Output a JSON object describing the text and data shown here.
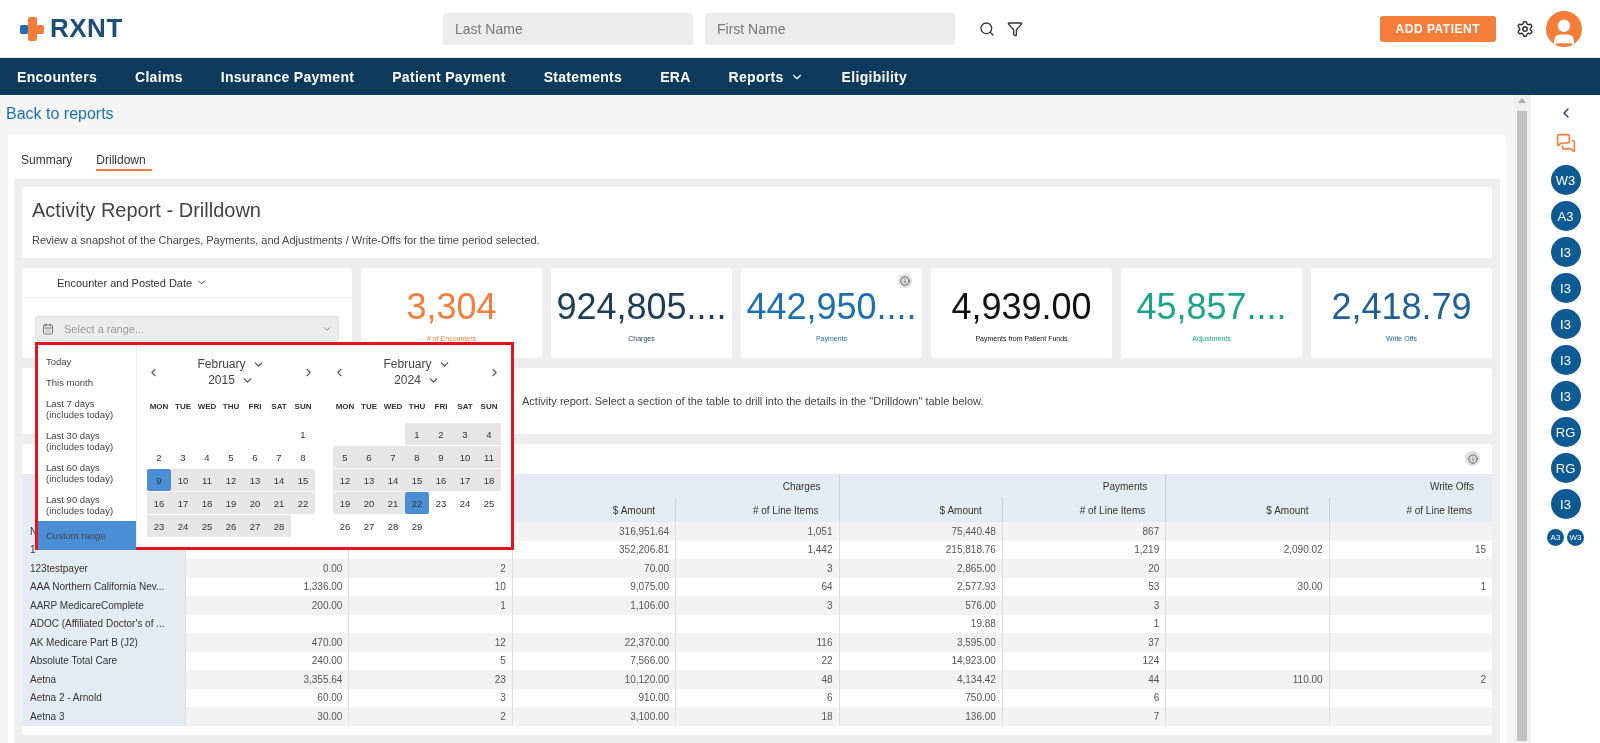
{
  "header": {
    "logo": "RXNT",
    "last_name_placeholder": "Last Name",
    "first_name_placeholder": "First Name",
    "add_button": "ADD PATIENT"
  },
  "nav": [
    {
      "label": "Encounters",
      "dropdown": false
    },
    {
      "label": "Claims",
      "dropdown": false
    },
    {
      "label": "Insurance Payment",
      "dropdown": false
    },
    {
      "label": "Patient Payment",
      "dropdown": false
    },
    {
      "label": "Statements",
      "dropdown": false
    },
    {
      "label": "ERA",
      "dropdown": false
    },
    {
      "label": "Reports",
      "dropdown": true
    },
    {
      "label": "Eligibility",
      "dropdown": false
    }
  ],
  "back_link": "Back to reports",
  "tabs": [
    {
      "label": "Summary",
      "selected": false
    },
    {
      "label": "Drilldown",
      "selected": true
    }
  ],
  "report": {
    "title": "Activity Report - Drilldown",
    "subtitle": "Review a snapshot of the Charges, Payments, and Adjustments / Write-Offs for the time period selected."
  },
  "date_filter": {
    "label": "Encounter and Posted Date",
    "placeholder": "Select a range..."
  },
  "stats": [
    {
      "value": "3,304",
      "label": "# of Encounters",
      "color": "#f47d3a",
      "info": false
    },
    {
      "value": "924,805....",
      "label": "Charges",
      "color": "#1c3d5a",
      "info": false
    },
    {
      "value": "442,950....",
      "label": "Payments",
      "color": "#1a6fb5",
      "info": true
    },
    {
      "value": "4,939.00",
      "label": "Payments from Patient Funds",
      "color": "#111111",
      "info": false
    },
    {
      "value": "45,857....",
      "label": "Adjustments",
      "color": "#1aa58a",
      "info": false
    },
    {
      "value": "2,418.79",
      "label": "Write Offs",
      "color": "#1f5f9a",
      "info": false
    }
  ],
  "date_picker": {
    "presets": [
      {
        "label": "Today",
        "selected": false
      },
      {
        "label": "This month",
        "selected": false
      },
      {
        "label": "Last 7 days\n(includes today)",
        "selected": false
      },
      {
        "label": "Last 30 days\n(includes today)",
        "selected": false
      },
      {
        "label": "Last 60 days\n(includes today)",
        "selected": false
      },
      {
        "label": "Last 90 days\n(includes today)",
        "selected": false
      },
      {
        "label": "Custom range",
        "selected": true
      }
    ],
    "months": [
      {
        "month": "February",
        "year": "2015",
        "weekdays": [
          "MON",
          "TUE",
          "WED",
          "THU",
          "FRI",
          "SAT",
          "SUN"
        ],
        "weeks": [
          {
            "kind": "lead",
            "days": [
              {
                "d": "1",
                "in_range": false,
                "selected": false
              }
            ]
          },
          {
            "kind": "full",
            "days": [
              {
                "d": "2",
                "in_range": false,
                "selected": false
              },
              {
                "d": "3",
                "in_range": false,
                "selected": false
              },
              {
                "d": "4",
                "in_range": false,
                "selected": false
              },
              {
                "d": "5",
                "in_range": false,
                "selected": false
              },
              {
                "d": "6",
                "in_range": false,
                "selected": false
              },
              {
                "d": "7",
                "in_range": false,
                "selected": false
              },
              {
                "d": "8",
                "in_range": false,
                "selected": false
              }
            ]
          },
          {
            "kind": "full",
            "days": [
              {
                "d": "9",
                "in_range": true,
                "selected": true
              },
              {
                "d": "10",
                "in_range": true,
                "selected": false
              },
              {
                "d": "11",
                "in_range": true,
                "selected": false
              },
              {
                "d": "12",
                "in_range": true,
                "selected": false
              },
              {
                "d": "13",
                "in_range": true,
                "selected": false
              },
              {
                "d": "14",
                "in_range": true,
                "selected": false
              },
              {
                "d": "15",
                "in_range": true,
                "selected": false
              }
            ]
          },
          {
            "kind": "full",
            "days": [
              {
                "d": "16",
                "in_range": true,
                "selected": false
              },
              {
                "d": "17",
                "in_range": true,
                "selected": false
              },
              {
                "d": "18",
                "in_range": true,
                "selected": false
              },
              {
                "d": "19",
                "in_range": true,
                "selected": false
              },
              {
                "d": "20",
                "in_range": true,
                "selected": false
              },
              {
                "d": "21",
                "in_range": true,
                "selected": false
              },
              {
                "d": "22",
                "in_range": true,
                "selected": false
              }
            ]
          },
          {
            "kind": "tail",
            "days": [
              {
                "d": "23",
                "in_range": true,
                "selected": false
              },
              {
                "d": "24",
                "in_range": true,
                "selected": false
              },
              {
                "d": "25",
                "in_range": true,
                "selected": false
              },
              {
                "d": "26",
                "in_range": true,
                "selected": false
              },
              {
                "d": "27",
                "in_range": true,
                "selected": false
              },
              {
                "d": "28",
                "in_range": true,
                "selected": false
              }
            ]
          }
        ]
      },
      {
        "month": "February",
        "year": "2024",
        "weekdays": [
          "MON",
          "TUE",
          "WED",
          "THU",
          "FRI",
          "SAT",
          "SUN"
        ],
        "weeks": [
          {
            "kind": "lead",
            "days": [
              {
                "d": "1",
                "in_range": true,
                "selected": false
              },
              {
                "d": "2",
                "in_range": true,
                "selected": false
              },
              {
                "d": "3",
                "in_range": true,
                "selected": false
              },
              {
                "d": "4",
                "in_range": true,
                "selected": false
              }
            ]
          },
          {
            "kind": "full",
            "days": [
              {
                "d": "5",
                "in_range": true,
                "selected": false
              },
              {
                "d": "6",
                "in_range": true,
                "selected": false
              },
              {
                "d": "7",
                "in_range": true,
                "selected": false
              },
              {
                "d": "8",
                "in_range": true,
                "selected": false
              },
              {
                "d": "9",
                "in_range": true,
                "selected": false
              },
              {
                "d": "10",
                "in_range": true,
                "selected": false
              },
              {
                "d": "11",
                "in_range": true,
                "selected": false
              }
            ]
          },
          {
            "kind": "full",
            "days": [
              {
                "d": "12",
                "in_range": true,
                "selected": false
              },
              {
                "d": "13",
                "in_range": true,
                "selected": false
              },
              {
                "d": "14",
                "in_range": true,
                "selected": false
              },
              {
                "d": "15",
                "in_range": true,
                "selected": false
              },
              {
                "d": "16",
                "in_range": true,
                "selected": false
              },
              {
                "d": "17",
                "in_range": true,
                "selected": false
              },
              {
                "d": "18",
                "in_range": true,
                "selected": false
              }
            ]
          },
          {
            "kind": "full",
            "days": [
              {
                "d": "19",
                "in_range": true,
                "selected": false
              },
              {
                "d": "20",
                "in_range": true,
                "selected": false
              },
              {
                "d": "21",
                "in_range": true,
                "selected": false
              },
              {
                "d": "22",
                "in_range": true,
                "selected": true
              },
              {
                "d": "23",
                "in_range": false,
                "selected": false
              },
              {
                "d": "24",
                "in_range": false,
                "selected": false
              },
              {
                "d": "25",
                "in_range": false,
                "selected": false
              }
            ]
          },
          {
            "kind": "tail",
            "days": [
              {
                "d": "26",
                "in_range": false,
                "selected": false
              },
              {
                "d": "27",
                "in_range": false,
                "selected": false
              },
              {
                "d": "28",
                "in_range": false,
                "selected": false
              },
              {
                "d": "29",
                "in_range": false,
                "selected": false
              }
            ]
          }
        ]
      }
    ]
  },
  "section_text": "Activity report. Select a section of the table to drill into the details in the \"Drilldown\" table below.",
  "table": {
    "groups": [
      "Charges",
      "Payments",
      "Write Offs"
    ],
    "columns": [
      "",
      "",
      "$ Amount",
      "# of Line Items",
      "$ Amount",
      "# of Line Items",
      "$ Amount",
      "# of Line Items"
    ],
    "rows": [
      {
        "payer": "N",
        "cells": [
          "",
          "",
          "316,951.64",
          "1,051",
          "75,440.48",
          "867",
          "",
          ""
        ]
      },
      {
        "payer": "1",
        "cells": [
          "",
          "",
          "352,206.81",
          "1,442",
          "215,818.76",
          "1,219",
          "2,090.02",
          "15"
        ]
      },
      {
        "payer": "123testpayer",
        "cells": [
          "0.00",
          "2",
          "70.00",
          "3",
          "2,865.00",
          "20",
          "",
          ""
        ]
      },
      {
        "payer": "AAA Northern California Nev...",
        "cells": [
          "1,336.00",
          "10",
          "9,075.00",
          "64",
          "2,577.93",
          "53",
          "30.00",
          "1"
        ]
      },
      {
        "payer": "AARP MedicareComplete",
        "cells": [
          "200.00",
          "1",
          "1,106.00",
          "3",
          "576.00",
          "3",
          "",
          ""
        ]
      },
      {
        "payer": "ADOC (Affiliated Doctor's of ...",
        "cells": [
          "",
          "",
          "",
          "",
          "19.88",
          "1",
          "",
          ""
        ]
      },
      {
        "payer": "AK Medicare Part B (J2)",
        "cells": [
          "470.00",
          "12",
          "22,370.00",
          "116",
          "3,595.00",
          "37",
          "",
          ""
        ]
      },
      {
        "payer": "Absolute Total Care",
        "cells": [
          "240.00",
          "5",
          "7,566.00",
          "22",
          "14,923.00",
          "124",
          "",
          ""
        ]
      },
      {
        "payer": "Aetna",
        "cells": [
          "3,355.64",
          "23",
          "10,120.00",
          "48",
          "4,134.42",
          "44",
          "110.00",
          "2"
        ]
      },
      {
        "payer": "Aetna 2 - Arnold",
        "cells": [
          "60.00",
          "3",
          "910.00",
          "6",
          "750.00",
          "6",
          "",
          ""
        ]
      },
      {
        "payer": "Aetna 3",
        "cells": [
          "30.00",
          "2",
          "3,100.00",
          "18",
          "136.00",
          "7",
          "",
          ""
        ]
      }
    ]
  },
  "rail": {
    "avatars": [
      "W3",
      "A3",
      "I3",
      "I3",
      "I3",
      "I3",
      "I3",
      "RG",
      "RG",
      "I3"
    ],
    "mini_avatars": [
      "A3",
      "W3"
    ]
  }
}
